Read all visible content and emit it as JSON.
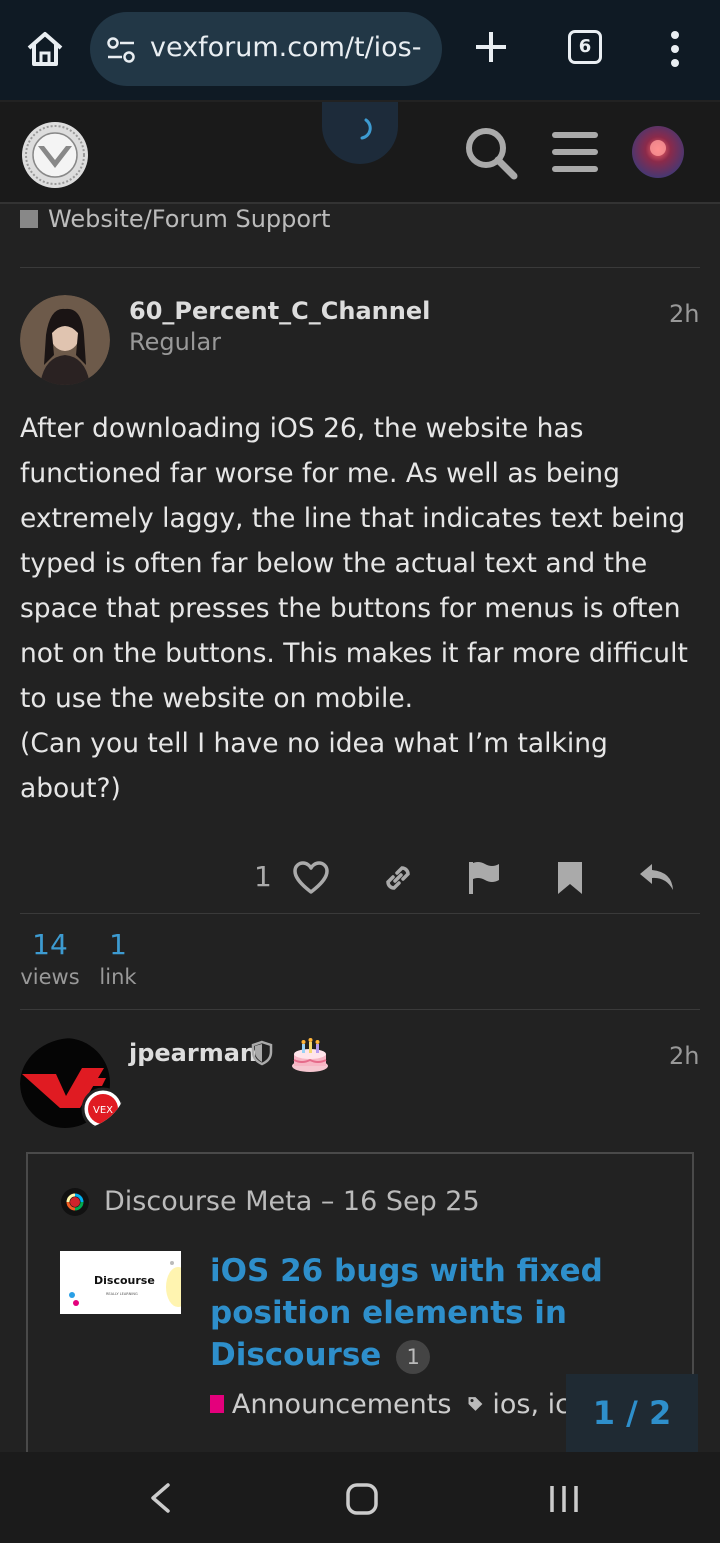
{
  "browser": {
    "url": "vexforum.com/t/ios-",
    "tab_count": "6"
  },
  "topic": {
    "category": "Website/Forum Support",
    "category_color": "#888888"
  },
  "first_post": {
    "username": "60_Percent_C_Channel",
    "user_title": "Regular",
    "time": "2h",
    "paragraphs": [
      "After downloading iOS 26, the website has functioned far worse for me. As well as being extremely laggy, the line that indicates text being typed is often far below the actual text and the space that presses the buttons for menus is often not on the buttons. This makes it far more difficult to use the website on mobile.",
      "(Can you tell I have no idea what I’m talking about?)"
    ],
    "like_count": "1"
  },
  "stats": {
    "views_count": "14",
    "views_label": "views",
    "links_count": "1",
    "links_label": "link"
  },
  "reply": {
    "username": "jpearman",
    "time": "2h",
    "onebox": {
      "source": "Discourse Meta – 16 Sep 25",
      "thumb_text": "Discourse",
      "thumb_subtext": "REALLY LEARNING",
      "title": "iOS 26 bugs with fixed position elements in Discourse",
      "reply_count": "1",
      "category": "Announcements",
      "category_color": "#e4007c",
      "tags": "ios, ic"
    }
  },
  "progress": "1 / 2",
  "colors": {
    "accent": "#2e8fcb",
    "stat_number": "#3d9bd1",
    "background": "#222222"
  }
}
